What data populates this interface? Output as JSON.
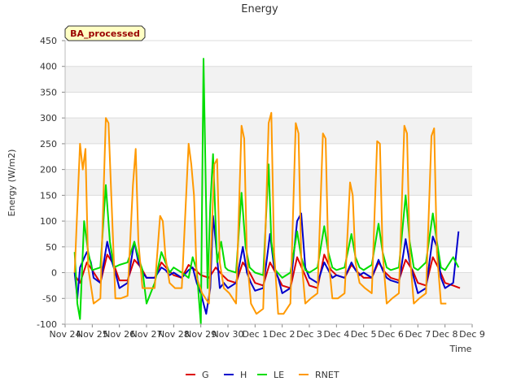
{
  "chart_data": {
    "type": "line",
    "title": "Energy",
    "badge": "BA_processed",
    "xlabel": "Time",
    "ylabel": "Energy (W/m2)",
    "xlim": [
      0,
      15
    ],
    "ylim": [
      -100,
      450
    ],
    "x_ticks": [
      {
        "value": 0,
        "label": "Nov 24"
      },
      {
        "value": 1,
        "label": "Nov 25"
      },
      {
        "value": 2,
        "label": "Nov 26"
      },
      {
        "value": 3,
        "label": "Nov 27"
      },
      {
        "value": 4,
        "label": "Nov 28"
      },
      {
        "value": 5,
        "label": "Nov 29"
      },
      {
        "value": 6,
        "label": "Nov 30"
      },
      {
        "value": 7,
        "label": "Dec 1"
      },
      {
        "value": 8,
        "label": "Dec 2"
      },
      {
        "value": 9,
        "label": "Dec 3"
      },
      {
        "value": 10,
        "label": "Dec 4"
      },
      {
        "value": 11,
        "label": "Dec 5"
      },
      {
        "value": 12,
        "label": "Dec 6"
      },
      {
        "value": 13,
        "label": "Dec 7"
      },
      {
        "value": 14,
        "label": "Dec 8"
      },
      {
        "value": 15,
        "label": "Dec 9"
      }
    ],
    "y_ticks": [
      -100,
      -50,
      0,
      50,
      100,
      150,
      200,
      250,
      300,
      350,
      400,
      450
    ],
    "legend_position": "bottom-center",
    "series": [
      {
        "name": "G",
        "color": "#dd0000",
        "x": [
          0.35,
          0.55,
          0.8,
          1.0,
          1.3,
          1.55,
          1.8,
          2.0,
          2.3,
          2.55,
          2.8,
          3.0,
          3.3,
          3.55,
          3.8,
          4.0,
          4.3,
          4.55,
          4.8,
          5.0,
          5.3,
          5.55,
          5.8,
          6.0,
          6.3,
          6.55,
          6.8,
          7.0,
          7.3,
          7.55,
          7.8,
          8.0,
          8.3,
          8.55,
          8.8,
          9.0,
          9.3,
          9.55,
          9.8,
          10.0,
          10.3,
          10.55,
          10.8,
          11.0,
          11.3,
          11.55,
          11.8,
          12.0,
          12.3,
          12.55,
          12.8,
          13.0,
          13.3,
          13.55,
          13.8,
          14.0,
          14.3,
          14.55
        ],
        "y": [
          -5,
          -20,
          20,
          5,
          -20,
          35,
          15,
          -15,
          -15,
          25,
          10,
          -10,
          -10,
          20,
          5,
          -5,
          -10,
          15,
          5,
          -5,
          -10,
          10,
          -5,
          -15,
          -20,
          20,
          0,
          -20,
          -25,
          20,
          -5,
          -25,
          -30,
          30,
          0,
          -25,
          -30,
          35,
          5,
          -5,
          -10,
          15,
          0,
          -10,
          -10,
          20,
          0,
          -10,
          -15,
          25,
          5,
          -20,
          -25,
          30,
          5,
          -20,
          -25,
          -30
        ]
      },
      {
        "name": "H",
        "color": "#0000cc",
        "x": [
          0.35,
          0.45,
          0.55,
          0.8,
          0.95,
          1.05,
          1.3,
          1.55,
          1.7,
          1.85,
          2.0,
          2.3,
          2.55,
          2.7,
          2.85,
          3.0,
          3.3,
          3.55,
          3.7,
          3.85,
          4.0,
          4.3,
          4.55,
          4.7,
          4.85,
          5.0,
          5.2,
          5.35,
          5.45,
          5.55,
          5.7,
          5.85,
          6.0,
          6.3,
          6.55,
          6.7,
          6.85,
          7.0,
          7.3,
          7.55,
          7.7,
          7.85,
          8.0,
          8.3,
          8.55,
          8.7,
          8.85,
          9.0,
          9.3,
          9.55,
          9.7,
          9.85,
          10.0,
          10.3,
          10.55,
          10.7,
          10.85,
          11.0,
          11.3,
          11.55,
          11.7,
          11.85,
          12.0,
          12.3,
          12.55,
          12.7,
          12.85,
          13.0,
          13.3,
          13.55,
          13.7,
          13.85,
          14.0,
          14.3,
          14.5
        ],
        "y": [
          0,
          -50,
          10,
          40,
          20,
          -10,
          -20,
          60,
          25,
          0,
          -30,
          -20,
          60,
          20,
          0,
          -10,
          -10,
          10,
          5,
          -5,
          0,
          -10,
          5,
          10,
          -20,
          -40,
          -80,
          -30,
          110,
          60,
          -30,
          -20,
          -30,
          -20,
          50,
          0,
          -20,
          -35,
          -30,
          75,
          10,
          -10,
          -40,
          -30,
          100,
          115,
          10,
          -10,
          -20,
          20,
          5,
          -10,
          -5,
          -10,
          20,
          5,
          -5,
          0,
          -10,
          25,
          5,
          -10,
          -15,
          -20,
          65,
          20,
          -10,
          -40,
          -30,
          70,
          50,
          -10,
          -30,
          -20,
          80
        ]
      },
      {
        "name": "LE",
        "color": "#00dd00",
        "x": [
          0.35,
          0.45,
          0.55,
          0.7,
          0.85,
          1.0,
          1.3,
          1.5,
          1.65,
          1.8,
          2.0,
          2.3,
          2.55,
          2.7,
          2.85,
          3.0,
          3.3,
          3.55,
          3.7,
          3.85,
          4.0,
          4.3,
          4.55,
          4.7,
          4.85,
          5.0,
          5.1,
          5.25,
          5.35,
          5.45,
          5.6,
          5.75,
          5.9,
          6.0,
          6.3,
          6.5,
          6.65,
          6.8,
          7.0,
          7.3,
          7.5,
          7.6,
          7.75,
          8.0,
          8.3,
          8.55,
          8.7,
          8.85,
          9.0,
          9.3,
          9.55,
          9.7,
          9.85,
          10.0,
          10.3,
          10.55,
          10.7,
          10.85,
          11.0,
          11.3,
          11.55,
          11.7,
          11.85,
          12.0,
          12.3,
          12.55,
          12.7,
          12.85,
          13.0,
          13.3,
          13.55,
          13.7,
          13.85,
          14.0,
          14.3,
          14.5
        ],
        "y": [
          40,
          -60,
          -90,
          100,
          40,
          5,
          10,
          170,
          60,
          10,
          15,
          20,
          60,
          30,
          5,
          -60,
          -20,
          40,
          20,
          0,
          10,
          0,
          -10,
          30,
          5,
          -100,
          415,
          -30,
          130,
          230,
          20,
          60,
          10,
          5,
          0,
          155,
          50,
          10,
          0,
          -5,
          210,
          60,
          5,
          -10,
          0,
          80,
          30,
          5,
          0,
          10,
          90,
          40,
          10,
          5,
          10,
          75,
          30,
          10,
          5,
          15,
          95,
          40,
          10,
          5,
          10,
          150,
          60,
          10,
          5,
          20,
          115,
          60,
          10,
          5,
          30,
          10
        ]
      },
      {
        "name": "RNET",
        "color": "#ff9900",
        "x": [
          0.35,
          0.55,
          0.65,
          0.75,
          0.85,
          1.05,
          1.3,
          1.5,
          1.6,
          1.7,
          1.85,
          2.05,
          2.3,
          2.5,
          2.6,
          2.7,
          2.85,
          3.05,
          3.3,
          3.5,
          3.6,
          3.7,
          3.85,
          4.05,
          4.3,
          4.55,
          4.65,
          4.75,
          4.85,
          5.05,
          5.3,
          5.5,
          5.6,
          5.7,
          5.85,
          6.05,
          6.3,
          6.5,
          6.6,
          6.7,
          6.85,
          7.05,
          7.3,
          7.5,
          7.6,
          7.7,
          7.85,
          8.05,
          8.3,
          8.5,
          8.6,
          8.7,
          8.85,
          9.05,
          9.3,
          9.5,
          9.6,
          9.7,
          9.85,
          10.05,
          10.3,
          10.5,
          10.6,
          10.7,
          10.85,
          11.05,
          11.3,
          11.5,
          11.6,
          11.7,
          11.85,
          12.05,
          12.3,
          12.5,
          12.6,
          12.7,
          12.85,
          13.05,
          13.3,
          13.5,
          13.6,
          13.7,
          13.85,
          14.05
        ],
        "y": [
          0,
          250,
          200,
          240,
          10,
          -60,
          -50,
          300,
          290,
          150,
          -50,
          -50,
          -45,
          170,
          240,
          60,
          -30,
          -30,
          -30,
          110,
          100,
          30,
          -20,
          -30,
          -30,
          250,
          210,
          150,
          -10,
          -40,
          -60,
          210,
          220,
          20,
          -30,
          -40,
          -60,
          285,
          260,
          30,
          -60,
          -80,
          -70,
          290,
          310,
          40,
          -80,
          -80,
          -60,
          290,
          270,
          30,
          -60,
          -50,
          -40,
          270,
          260,
          30,
          -50,
          -50,
          -40,
          175,
          150,
          20,
          -20,
          -30,
          -40,
          255,
          250,
          40,
          -60,
          -50,
          -40,
          285,
          270,
          40,
          -60,
          -50,
          -40,
          265,
          280,
          40,
          -60,
          -60
        ]
      }
    ]
  }
}
